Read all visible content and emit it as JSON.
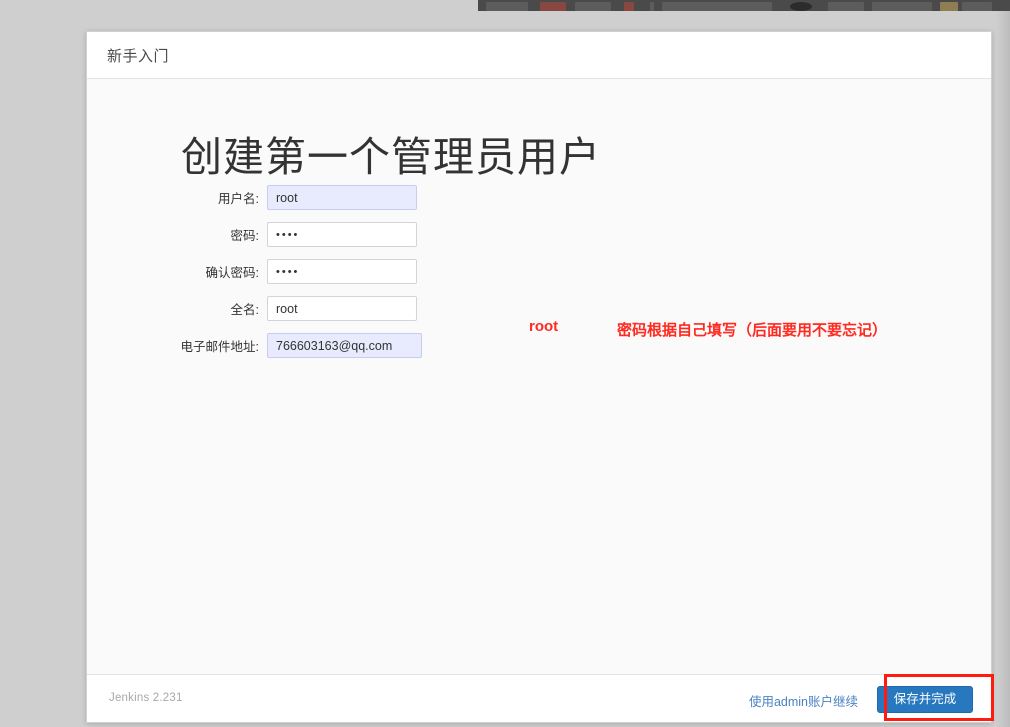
{
  "window": {
    "background_color": "#cfcfcf",
    "top_strip_color": "#4a4a4a"
  },
  "card": {
    "header": {
      "title": "新手入门"
    },
    "body": {
      "setup_title": "创建第一个管理员用户",
      "form": {
        "fields": [
          {
            "label": "用户名:",
            "value": "root",
            "type": "text",
            "autofilled": true
          },
          {
            "label": "密码:",
            "value": "••••",
            "type": "password",
            "autofilled": false
          },
          {
            "label": "确认密码:",
            "value": "••••",
            "type": "password",
            "autofilled": false
          },
          {
            "label": "全名:",
            "value": "root",
            "type": "text",
            "autofilled": false
          },
          {
            "label": "电子邮件地址:",
            "value": "766603163@qq.com",
            "type": "email",
            "autofilled": true
          }
        ]
      }
    },
    "footer": {
      "version": "Jenkins 2.231",
      "admin_link": "使用admin账户继续",
      "save_button": "保存并完成",
      "save_button_color": "#2878c0",
      "link_color": "#4b82c4"
    }
  },
  "annotations": {
    "color": "#ff2a20",
    "username_note": "root",
    "password_note": "密码根据自己填写（后面要用不要忘记）",
    "highlight_color": "#ff1b10"
  }
}
